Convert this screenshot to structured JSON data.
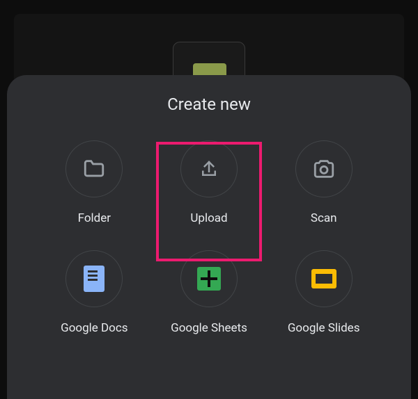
{
  "sheet": {
    "title": "Create new",
    "items": [
      {
        "label": "Folder"
      },
      {
        "label": "Upload"
      },
      {
        "label": "Scan"
      },
      {
        "label": "Google Docs"
      },
      {
        "label": "Google Sheets"
      },
      {
        "label": "Google Slides"
      }
    ],
    "highlighted_index": 1
  }
}
